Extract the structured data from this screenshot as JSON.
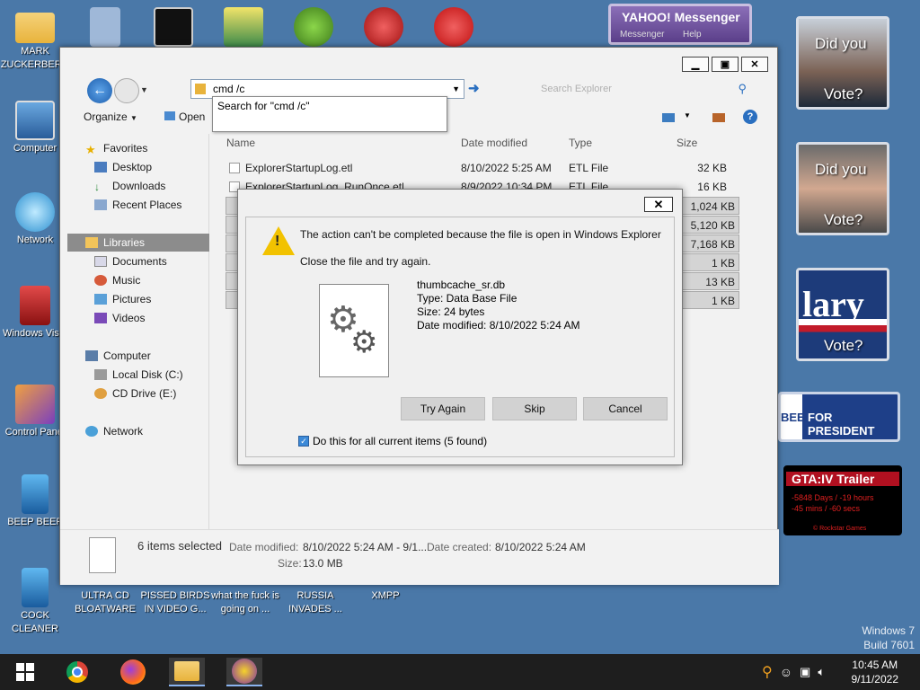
{
  "desktop": {
    "icons": [
      {
        "label": "MARK ZUCKERBERG",
        "icon": "folder-icon"
      },
      {
        "label": "Computer",
        "icon": "computer-icon"
      },
      {
        "label": "Network",
        "icon": "network-icon"
      },
      {
        "label": "Windows Vista",
        "icon": "recycle-bin-icon"
      },
      {
        "label": "Control Panel",
        "icon": "control-panel-icon"
      },
      {
        "label": "BEEP BEEP",
        "icon": "app-icon"
      },
      {
        "label": "COCK CLEANER",
        "icon": "app-icon"
      },
      {
        "label": "ULTRA CD BLOATWARE",
        "icon": "cd-icon"
      },
      {
        "label": "PISSED BIRDS IN VIDEO G...",
        "icon": "game-icon"
      },
      {
        "label": "what the fuck is going on ...",
        "icon": "game-icon"
      },
      {
        "label": "RUSSIA INVADES ...",
        "icon": "app-icon"
      },
      {
        "label": "XMPP",
        "icon": "app-icon"
      }
    ],
    "gadgets": {
      "g1": {
        "line1": "Did you",
        "line2": "Vote?"
      },
      "g2": {
        "line1": "Did you",
        "line2": "Vote?"
      },
      "g3": {
        "line1": "lary",
        "line2": "Vote?"
      },
      "g4": {
        "text": "FOR PRESIDENT",
        "side": "BEE"
      },
      "g5": {
        "title": "GTA:IV Trailer",
        "line1": "-5848 Days / -19 hours",
        "line2": "-45 mins / -60 secs",
        "footer": "© Rockstar Games"
      },
      "yahoo": {
        "title": "YAHOO! Messenger",
        "sub1": "Messenger",
        "sub2": "Help"
      }
    },
    "watermark": {
      "line1": "Windows 7",
      "line2": "Build 7601"
    }
  },
  "explorer": {
    "address_value": "cmd /c",
    "search_placeholder": "Search Explorer",
    "suggestion": "Search for \"cmd /c\"",
    "toolbar": {
      "organize": "Organize",
      "open": "Open"
    },
    "nav": {
      "favorites": "Favorites",
      "desktop": "Desktop",
      "downloads": "Downloads",
      "recent": "Recent Places",
      "libraries": "Libraries",
      "documents": "Documents",
      "music": "Music",
      "pictures": "Pictures",
      "videos": "Videos",
      "computer": "Computer",
      "local_disk": "Local Disk (C:)",
      "cd_drive": "CD Drive (E:)",
      "network": "Network"
    },
    "columns": {
      "name": "Name",
      "date": "Date modified",
      "type": "Type",
      "size": "Size"
    },
    "files": [
      {
        "name": "ExplorerStartupLog.etl",
        "date": "8/10/2022 5:25 AM",
        "type": "ETL File",
        "size": "32 KB"
      },
      {
        "name": "ExplorerStartupLog_RunOnce.etl",
        "date": "8/9/2022 10:34 PM",
        "type": "ETL File",
        "size": "16 KB"
      },
      {
        "name": "",
        "date": "",
        "type": "",
        "size": "1,024 KB"
      },
      {
        "name": "",
        "date": "",
        "type": "",
        "size": "5,120 KB"
      },
      {
        "name": "",
        "date": "",
        "type": "",
        "size": "7,168 KB"
      },
      {
        "name": "",
        "date": "",
        "type": "",
        "size": "1 KB"
      },
      {
        "name": "",
        "date": "",
        "type": "",
        "size": "13 KB"
      },
      {
        "name": "",
        "date": "",
        "type": "",
        "size": "1 KB"
      }
    ],
    "status": {
      "count": "6 items selected",
      "date_modified_label": "Date modified:",
      "date_modified_value": "8/10/2022 5:24 AM - 9/1...",
      "date_created_label": "Date created:",
      "date_created_value": "8/10/2022 5:24 AM",
      "size_label": "Size:",
      "size_value": "13.0 MB"
    }
  },
  "dialog": {
    "message": "The action can't be completed because the file is open in Windows Explorer",
    "instruction": "Close the file and try again.",
    "file_name": "thumbcache_sr.db",
    "file_type": "Type: Data Base File",
    "file_size": "Size: 24 bytes",
    "file_date": "Date modified: 8/10/2022 5:24 AM",
    "btn_try": "Try Again",
    "btn_skip": "Skip",
    "btn_cancel": "Cancel",
    "checkbox_label": "Do this for all current items (5 found)",
    "checkbox_checked": true
  },
  "taskbar": {
    "time": "10:45 AM",
    "date": "9/11/2022"
  },
  "colors": {
    "desktop": "#4a78a8",
    "accent": "#3c8ad8",
    "warning": "#f2c200"
  }
}
